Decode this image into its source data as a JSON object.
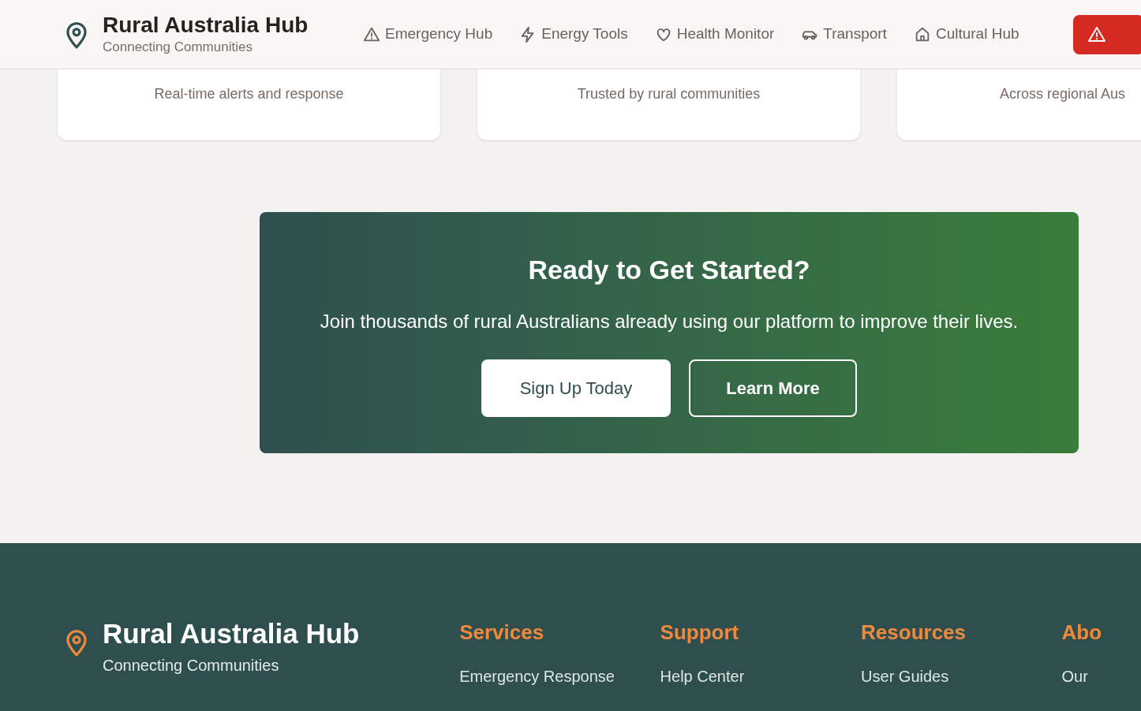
{
  "header": {
    "title": "Rural Australia Hub",
    "subtitle": "Connecting Communities",
    "nav": [
      {
        "label": "Emergency Hub"
      },
      {
        "label": "Energy Tools"
      },
      {
        "label": "Health Monitor"
      },
      {
        "label": "Transport"
      },
      {
        "label": "Cultural Hub"
      }
    ]
  },
  "stat_cards": [
    {
      "caption": "Real-time alerts and response"
    },
    {
      "caption": "Trusted by rural communities"
    },
    {
      "caption": "Across regional Aus"
    }
  ],
  "cta": {
    "title": "Ready to Get Started?",
    "text": "Join thousands of rural Australians already using our platform to improve their lives.",
    "buttons": [
      {
        "label": "Sign Up Today",
        "kind": "primary"
      },
      {
        "label": "Learn More",
        "kind": "outline"
      }
    ]
  },
  "footer": {
    "title": "Rural Australia Hub",
    "subtitle": "Connecting Communities",
    "columns": [
      {
        "heading": "Services",
        "links": [
          "Emergency Response"
        ]
      },
      {
        "heading": "Support",
        "links": [
          "Help Center"
        ]
      },
      {
        "heading": "Resources",
        "links": [
          "User Guides"
        ]
      },
      {
        "heading": "Abo",
        "links": [
          "Our"
        ]
      }
    ]
  }
}
